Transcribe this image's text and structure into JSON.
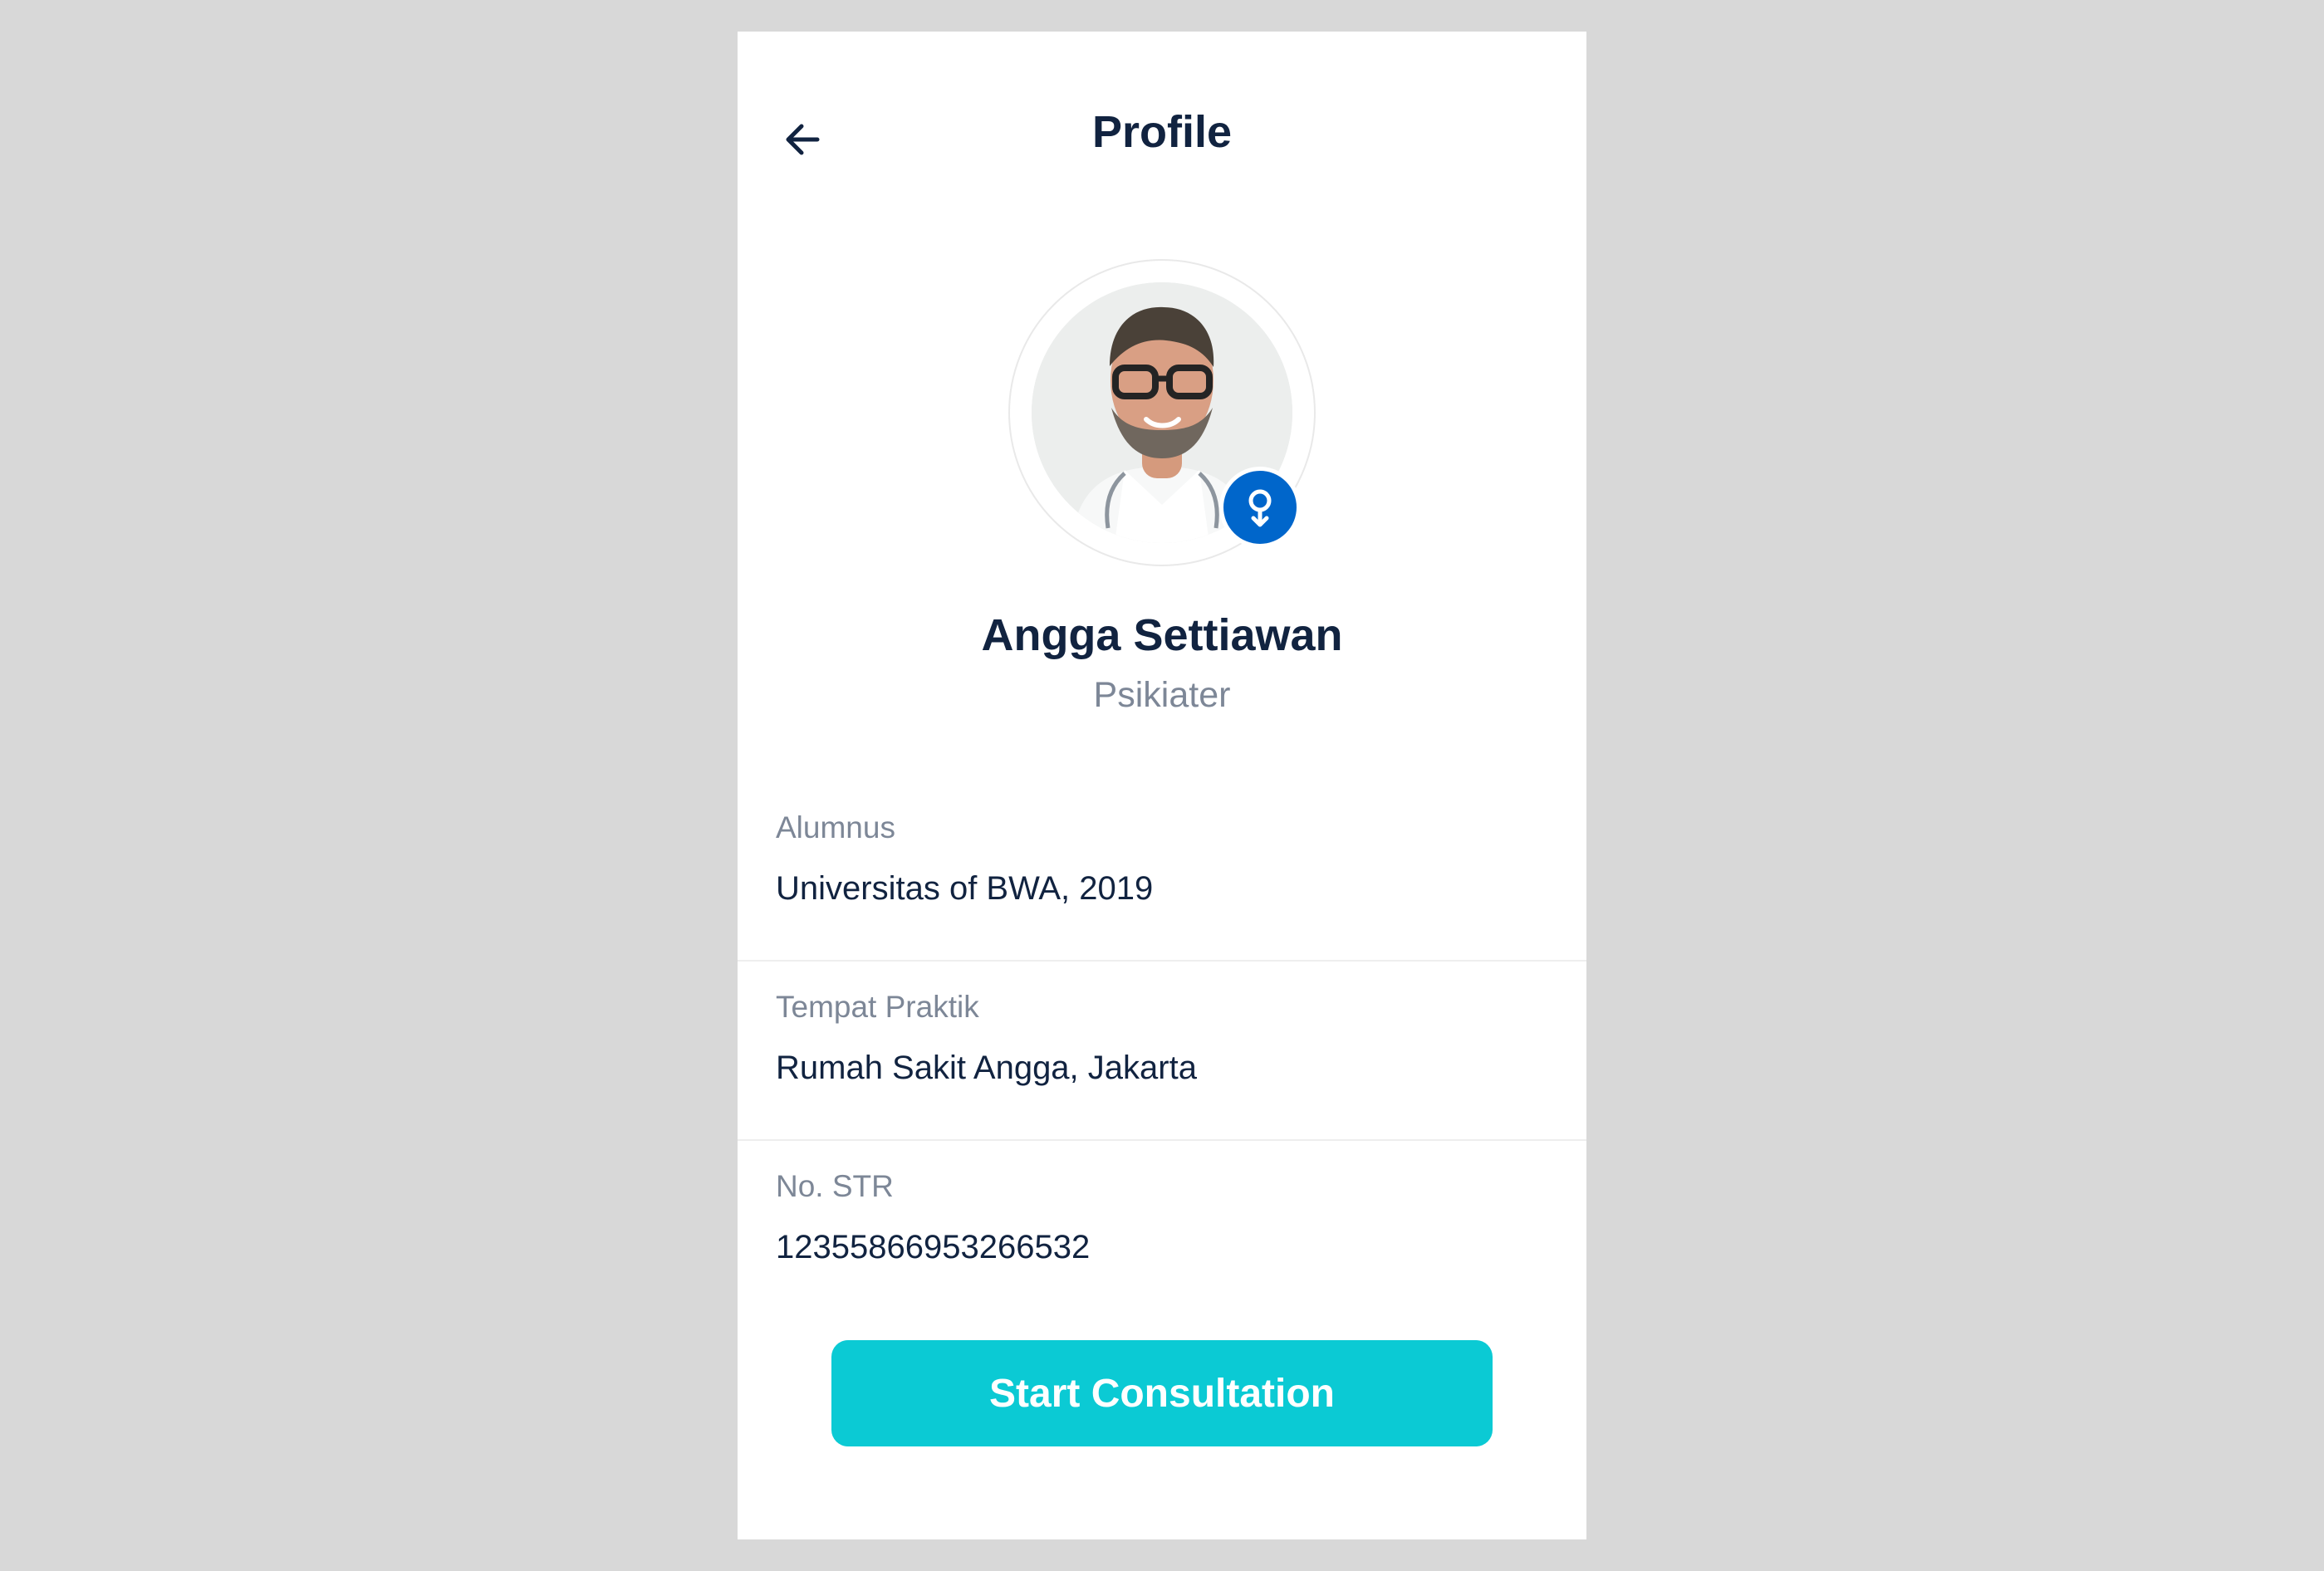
{
  "header": {
    "title": "Profile",
    "back_icon": "arrow-left-icon"
  },
  "profile": {
    "name": "Angga Settiawan",
    "role": "Psikiater",
    "gender_icon": "female-gender-icon",
    "avatar_alt": "doctor-avatar"
  },
  "details": [
    {
      "label": "Alumnus",
      "value": "Universitas of BWA, 2019"
    },
    {
      "label": "Tempat Praktik",
      "value": "Rumah Sakit Angga, Jakarta"
    },
    {
      "label": "No. STR",
      "value": "12355866953266532"
    }
  ],
  "actions": {
    "start_consultation": "Start Consultation"
  },
  "colors": {
    "page_background": "#D8D8D8",
    "card_background": "#FFFFFF",
    "title": "#112340",
    "muted": "#7D8797",
    "accent": "#0BCAD4",
    "badge": "#0066CB",
    "divider": "#EEEEEE"
  }
}
